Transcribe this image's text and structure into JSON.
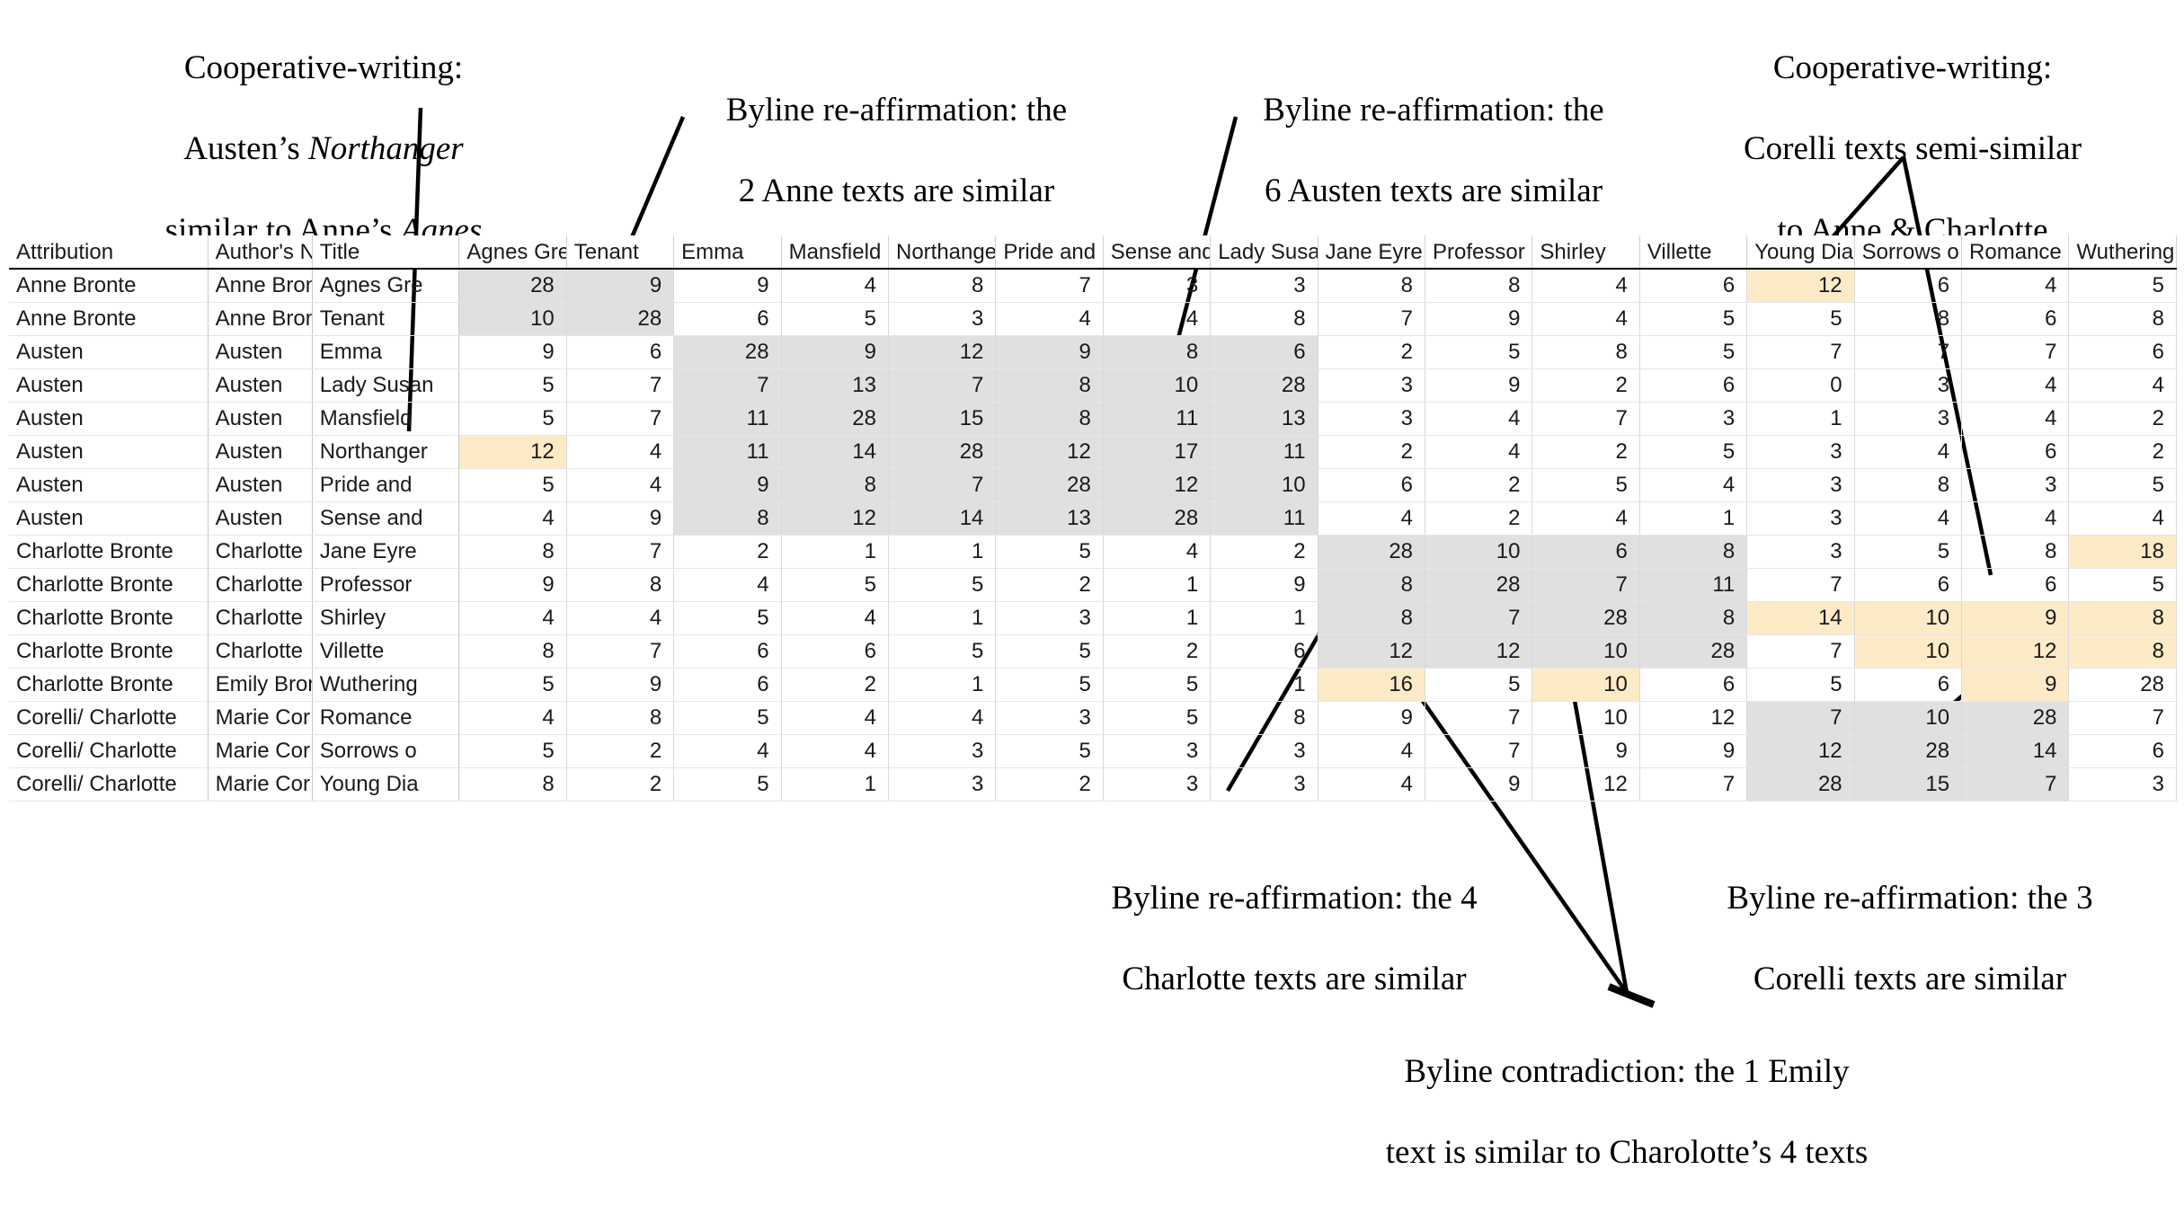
{
  "annotations": [
    {
      "id": "anno-northanger-agnes",
      "lines": [
        "Cooperative-writing:",
        "Austen’s |Northanger|",
        "similar to Anne’s |Agnes|"
      ],
      "plain": "Cooperative-writing: Austen’s Northanger similar to Anne’s Agnes"
    },
    {
      "id": "anno-anne-2",
      "lines": [
        "Byline re-affirmation: the",
        "2 Anne texts are similar"
      ],
      "plain": "Byline re-affirmation: the 2 Anne texts are similar"
    },
    {
      "id": "anno-austen-6",
      "lines": [
        "Byline re-affirmation: the",
        "6 Austen texts are similar"
      ],
      "plain": "Byline re-affirmation: the 6 Austen texts are similar"
    },
    {
      "id": "anno-corelli-semi",
      "lines": [
        "Cooperative-writing:",
        "Corelli texts semi-similar",
        "to Anne & Charlotte"
      ],
      "plain": "Cooperative-writing: Corelli texts semi-similar to Anne & Charlotte"
    },
    {
      "id": "anno-charlotte-4",
      "lines": [
        "Byline re-affirmation: the 4",
        "Charlotte texts are similar"
      ],
      "plain": "Byline re-affirmation: the 4 Charlotte texts are similar"
    },
    {
      "id": "anno-corelli-3",
      "lines": [
        "Byline re-affirmation: the 3",
        "Corelli texts are similar"
      ],
      "plain": "Byline re-affirmation: the 3 Corelli texts are similar"
    },
    {
      "id": "anno-emily-contradiction",
      "lines": [
        "Byline contradiction: the 1 Emily",
        "text is similar to Charolotte’s 4 texts"
      ],
      "plain": "Byline contradiction: the 1 Emily text is similar to Charolotte’s 4 texts"
    }
  ],
  "table": {
    "headers": [
      "Attribution",
      "Author's N",
      "Title",
      "Agnes Gre",
      "Tenant",
      "Emma",
      "Mansfield",
      "Northange",
      "Pride and",
      "Sense and",
      "Lady Susa",
      "Jane Eyre",
      "Professor",
      "Shirley",
      "Villette",
      "Young Dia",
      "Sorrows o",
      "Romance",
      "Wuthering"
    ],
    "rows": [
      {
        "attribution": "Anne Bronte",
        "author": "Anne Bron",
        "title": "Agnes Gre",
        "values": [
          28,
          9,
          9,
          4,
          8,
          7,
          3,
          3,
          8,
          8,
          4,
          6,
          12,
          6,
          4,
          5
        ]
      },
      {
        "attribution": "Anne Bronte",
        "author": "Anne Bron",
        "title": "Tenant",
        "values": [
          10,
          28,
          6,
          5,
          3,
          4,
          4,
          8,
          7,
          9,
          4,
          5,
          5,
          8,
          6,
          8
        ]
      },
      {
        "attribution": "Austen",
        "author": "Austen",
        "title": "Emma",
        "values": [
          9,
          6,
          28,
          9,
          12,
          9,
          8,
          6,
          2,
          5,
          8,
          5,
          7,
          7,
          7,
          6
        ]
      },
      {
        "attribution": "Austen",
        "author": "Austen",
        "title": "Lady Susan",
        "values": [
          5,
          7,
          7,
          13,
          7,
          8,
          10,
          28,
          3,
          9,
          2,
          6,
          0,
          3,
          4,
          4
        ]
      },
      {
        "attribution": "Austen",
        "author": "Austen",
        "title": "Mansfield",
        "values": [
          5,
          7,
          11,
          28,
          15,
          8,
          11,
          13,
          3,
          4,
          7,
          3,
          1,
          3,
          4,
          2
        ]
      },
      {
        "attribution": "Austen",
        "author": "Austen",
        "title": "Northanger",
        "values": [
          12,
          4,
          11,
          14,
          28,
          12,
          17,
          11,
          2,
          4,
          2,
          5,
          3,
          4,
          6,
          2
        ]
      },
      {
        "attribution": "Austen",
        "author": "Austen",
        "title": "Pride and",
        "values": [
          5,
          4,
          9,
          8,
          7,
          28,
          12,
          10,
          6,
          2,
          5,
          4,
          3,
          8,
          3,
          5
        ]
      },
      {
        "attribution": "Austen",
        "author": "Austen",
        "title": "Sense and",
        "values": [
          4,
          9,
          8,
          12,
          14,
          13,
          28,
          11,
          4,
          2,
          4,
          1,
          3,
          4,
          4,
          4
        ]
      },
      {
        "attribution": "Charlotte Bronte",
        "author": "Charlotte",
        "title": "Jane Eyre",
        "values": [
          8,
          7,
          2,
          1,
          1,
          5,
          4,
          2,
          28,
          10,
          6,
          8,
          3,
          5,
          8,
          18
        ]
      },
      {
        "attribution": "Charlotte Bronte",
        "author": "Charlotte",
        "title": "Professor",
        "values": [
          9,
          8,
          4,
          5,
          5,
          2,
          1,
          9,
          8,
          28,
          7,
          11,
          7,
          6,
          6,
          5
        ]
      },
      {
        "attribution": "Charlotte Bronte",
        "author": "Charlotte",
        "title": "Shirley",
        "values": [
          4,
          4,
          5,
          4,
          1,
          3,
          1,
          1,
          8,
          7,
          28,
          8,
          14,
          10,
          9,
          8
        ]
      },
      {
        "attribution": "Charlotte Bronte",
        "author": "Charlotte",
        "title": "Villette",
        "values": [
          8,
          7,
          6,
          6,
          5,
          5,
          2,
          6,
          12,
          12,
          10,
          28,
          7,
          10,
          12,
          8
        ]
      },
      {
        "attribution": "Charlotte Bronte",
        "author": "Emily Bron",
        "title": "Wuthering",
        "values": [
          5,
          9,
          6,
          2,
          1,
          5,
          5,
          1,
          16,
          5,
          10,
          6,
          5,
          6,
          9,
          28
        ]
      },
      {
        "attribution": "Corelli/ Charlotte",
        "author": "Marie Cor",
        "title": "Romance",
        "values": [
          4,
          8,
          5,
          4,
          4,
          3,
          5,
          8,
          9,
          7,
          10,
          12,
          7,
          10,
          28,
          7
        ]
      },
      {
        "attribution": "Corelli/ Charlotte",
        "author": "Marie Cor",
        "title": "Sorrows o",
        "values": [
          5,
          2,
          4,
          4,
          3,
          5,
          3,
          3,
          4,
          7,
          9,
          9,
          12,
          28,
          14,
          6
        ]
      },
      {
        "attribution": "Corelli/ Charlotte",
        "author": "Marie Cor",
        "title": "Young Dia",
        "values": [
          8,
          2,
          5,
          1,
          3,
          2,
          3,
          3,
          4,
          9,
          12,
          7,
          28,
          15,
          7,
          3
        ]
      }
    ],
    "band_cells": [
      [
        0,
        0
      ],
      [
        0,
        1
      ],
      [
        1,
        0
      ],
      [
        1,
        1
      ],
      [
        2,
        2
      ],
      [
        2,
        3
      ],
      [
        2,
        4
      ],
      [
        2,
        5
      ],
      [
        2,
        6
      ],
      [
        2,
        7
      ],
      [
        3,
        2
      ],
      [
        3,
        3
      ],
      [
        3,
        4
      ],
      [
        3,
        5
      ],
      [
        3,
        6
      ],
      [
        3,
        7
      ],
      [
        4,
        2
      ],
      [
        4,
        3
      ],
      [
        4,
        4
      ],
      [
        4,
        5
      ],
      [
        4,
        6
      ],
      [
        4,
        7
      ],
      [
        5,
        2
      ],
      [
        5,
        3
      ],
      [
        5,
        4
      ],
      [
        5,
        5
      ],
      [
        5,
        6
      ],
      [
        5,
        7
      ],
      [
        6,
        2
      ],
      [
        6,
        3
      ],
      [
        6,
        4
      ],
      [
        6,
        5
      ],
      [
        6,
        6
      ],
      [
        6,
        7
      ],
      [
        7,
        2
      ],
      [
        7,
        3
      ],
      [
        7,
        4
      ],
      [
        7,
        5
      ],
      [
        7,
        6
      ],
      [
        7,
        7
      ],
      [
        8,
        8
      ],
      [
        8,
        9
      ],
      [
        8,
        10
      ],
      [
        8,
        11
      ],
      [
        9,
        8
      ],
      [
        9,
        9
      ],
      [
        9,
        10
      ],
      [
        9,
        11
      ],
      [
        10,
        8
      ],
      [
        10,
        9
      ],
      [
        10,
        10
      ],
      [
        10,
        11
      ],
      [
        11,
        8
      ],
      [
        11,
        9
      ],
      [
        11,
        10
      ],
      [
        11,
        11
      ],
      [
        13,
        12
      ],
      [
        13,
        13
      ],
      [
        13,
        14
      ],
      [
        14,
        12
      ],
      [
        14,
        13
      ],
      [
        14,
        14
      ],
      [
        15,
        12
      ],
      [
        15,
        13
      ],
      [
        15,
        14
      ]
    ],
    "highlight_cells": [
      [
        0,
        12
      ],
      [
        5,
        0
      ],
      [
        8,
        15
      ],
      [
        10,
        12
      ],
      [
        10,
        13
      ],
      [
        10,
        14
      ],
      [
        10,
        15
      ],
      [
        11,
        13
      ],
      [
        11,
        14
      ],
      [
        11,
        15
      ],
      [
        12,
        8
      ],
      [
        12,
        10
      ],
      [
        12,
        14
      ]
    ],
    "colors": {
      "band": "#e0e0e0",
      "highlight": "#fdebc8",
      "grid_line": "#e6e6e6",
      "header_rule": "#000000",
      "text": "#1a1a1a"
    }
  }
}
